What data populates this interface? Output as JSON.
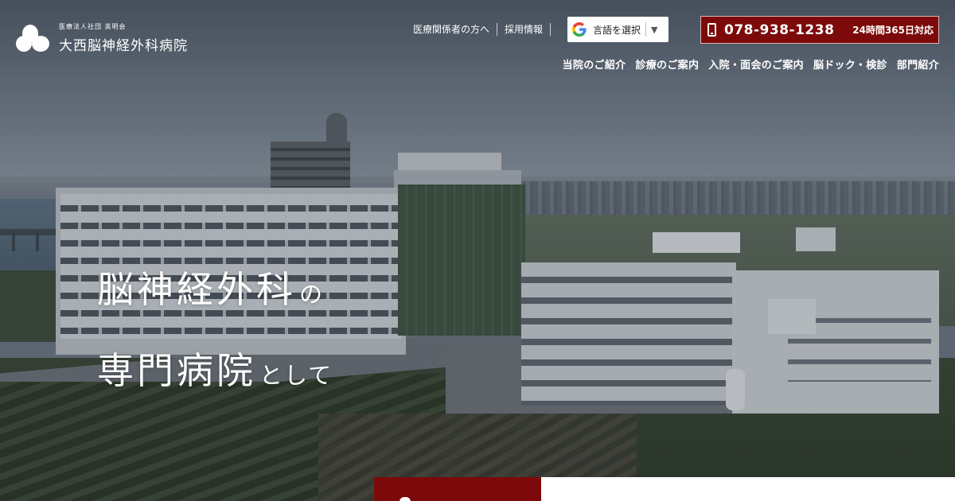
{
  "header": {
    "logo": {
      "sub": "医療法人社団 英明会",
      "name": "大西脳神経外科病院"
    },
    "top_links": [
      {
        "label": "医療関係者の方へ"
      },
      {
        "label": "採用情報"
      }
    ],
    "language_select": {
      "icon": "google-g-icon",
      "label": "言語を選択",
      "arrow": "▼"
    },
    "phone": {
      "icon": "smartphone-icon",
      "number": "078-938-1238",
      "hours": "24時間365日対応"
    },
    "nav": [
      {
        "label": "当院のご紹介"
      },
      {
        "label": "診療のご案内"
      },
      {
        "label": "入院・面会のご案内"
      },
      {
        "label": "脳ドック・検診"
      },
      {
        "label": "部門紹介"
      }
    ]
  },
  "hero": {
    "line1_big": "脳神経外科",
    "line1_small": "の",
    "line2_big": "専門病院",
    "line2_small": "として"
  },
  "colors": {
    "accent": "#7d0a0a",
    "text": "#ffffff"
  }
}
